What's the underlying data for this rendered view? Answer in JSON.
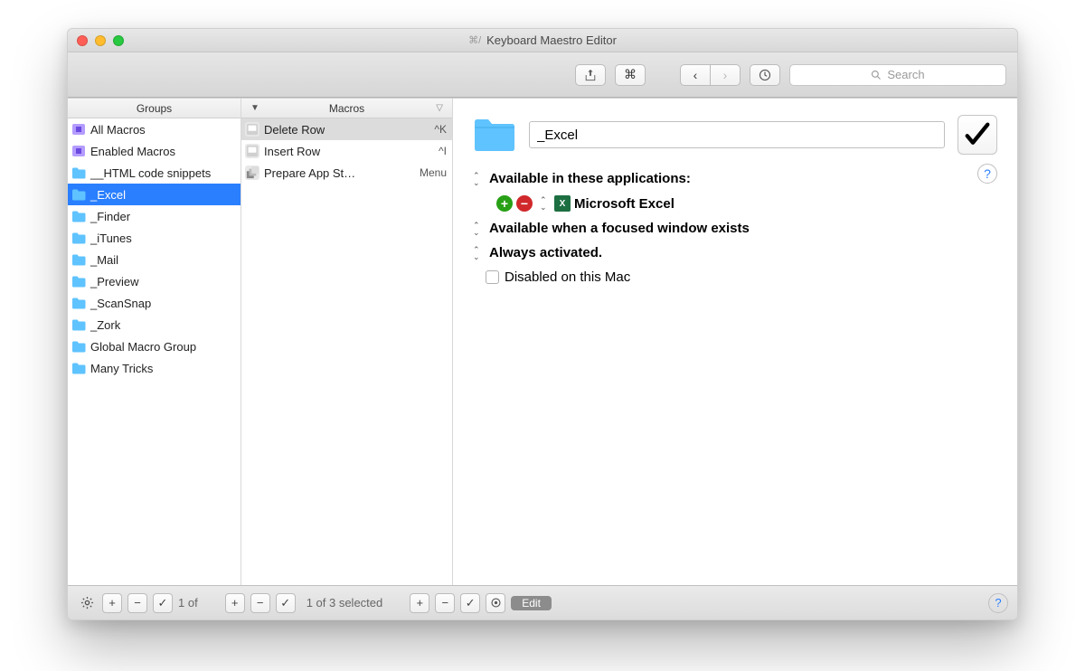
{
  "window": {
    "title": "Keyboard Maestro Editor",
    "doc_icon": "⌘/"
  },
  "toolbar": {
    "share_label": "Share",
    "shortcut_label": "⌘",
    "back_label": "‹",
    "forward_label": "›",
    "history_label": "History",
    "search_placeholder": "Search"
  },
  "columns": {
    "groups_header": "Groups",
    "macros_header": "Macros"
  },
  "groups": [
    {
      "name": "All Macros",
      "icon": "folder-square"
    },
    {
      "name": "Enabled Macros",
      "icon": "folder-square"
    },
    {
      "name": "__HTML code snippets",
      "icon": "folder"
    },
    {
      "name": "_Excel",
      "icon": "folder",
      "selected": true
    },
    {
      "name": "_Finder",
      "icon": "folder"
    },
    {
      "name": "_iTunes",
      "icon": "folder"
    },
    {
      "name": "_Mail",
      "icon": "folder"
    },
    {
      "name": "_Preview",
      "icon": "folder"
    },
    {
      "name": "_ScanSnap",
      "icon": "folder"
    },
    {
      "name": "_Zork",
      "icon": "folder"
    },
    {
      "name": "Global Macro Group",
      "icon": "folder"
    },
    {
      "name": "Many Tricks",
      "icon": "folder"
    }
  ],
  "macros": [
    {
      "name": "Delete Row",
      "shortcut": "^K",
      "icon": "app",
      "selected": true
    },
    {
      "name": "Insert Row",
      "shortcut": "^I",
      "icon": "app"
    },
    {
      "name": "Prepare App St…",
      "shortcut": "Menu",
      "icon": "stack"
    }
  ],
  "detail": {
    "group_name": "_Excel",
    "available_apps_label": "Available in these applications:",
    "apps": [
      {
        "name": "Microsoft Excel"
      }
    ],
    "window_condition": "Available when a focused window exists",
    "activation": "Always activated.",
    "disabled_label": "Disabled on this Mac",
    "disabled_checked": false
  },
  "bottom": {
    "groups_status": "1 of",
    "macros_status": "1 of 3 selected",
    "edit_label": "Edit"
  }
}
